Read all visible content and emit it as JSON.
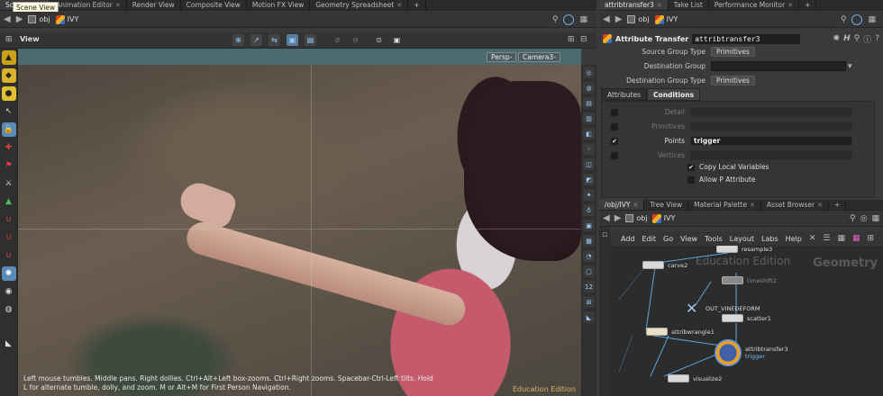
{
  "left_tabs": [
    "Scene View",
    "Animation Editor",
    "Render View",
    "Composite View",
    "Motion FX View",
    "Geometry Spreadsheet"
  ],
  "tooltip": "Scene View",
  "left_path": {
    "obj": "obj",
    "node": "IVY"
  },
  "viewer": {
    "label": "View",
    "persp": "Persp-",
    "camera": "Camera3-",
    "hint": "Left mouse tumbles. Middle pans. Right dollies. Ctrl+Alt+Left box-zooms. Ctrl+Right zooms. Spacebar-Ctrl-Left tilts. Hold L for alternate tumble, dolly, and zoom.    M or Alt+M for First Person Navigation.",
    "edu": "Education Edition"
  },
  "right_tabs": [
    "attribtransfer3",
    "Take List",
    "Performance Monitor"
  ],
  "right_path": {
    "obj": "obj",
    "node": "IVY"
  },
  "params": {
    "sop_type": "Attribute Transfer",
    "sop_name": "attribtransfer3",
    "source_group_type_label": "Source Group Type",
    "source_group_type_value": "Primitives",
    "dest_group_label": "Destination Group",
    "dest_group_type_label": "Destination Group Type",
    "dest_group_type_value": "Primitives",
    "tabs": [
      "Attributes",
      "Conditions"
    ],
    "rows": [
      {
        "label": "Detail",
        "value": "",
        "checked": false,
        "on": false
      },
      {
        "label": "Primitives",
        "value": "",
        "checked": false,
        "on": false
      },
      {
        "label": "Points",
        "value": "trigger",
        "checked": true,
        "on": true
      },
      {
        "label": "Vertices",
        "value": "",
        "checked": false,
        "on": false
      }
    ],
    "copy_local_label": "Copy Local Variables",
    "allow_p_label": "Allow P Attribute"
  },
  "net_tabs": [
    "/obj/IVY",
    "Tree View",
    "Material Palette",
    "Asset Browser"
  ],
  "net_path": {
    "obj": "obj",
    "node": "IVY"
  },
  "net_menu": [
    "Add",
    "Edit",
    "Go",
    "View",
    "Tools",
    "Layout",
    "Labs",
    "Help"
  ],
  "network": {
    "edu": "Education Edition",
    "context": "Geometry",
    "nodes": {
      "resample": "resample3",
      "carve": "carve2",
      "timeshift": "timeshift2",
      "out": "OUT_VINEDEFORM",
      "scatter": "scatter1",
      "wrangle": "attribwrangle1",
      "transfer": "attribtransfer3",
      "transfer_sub": "trigger",
      "visualize": "visualize2"
    }
  }
}
